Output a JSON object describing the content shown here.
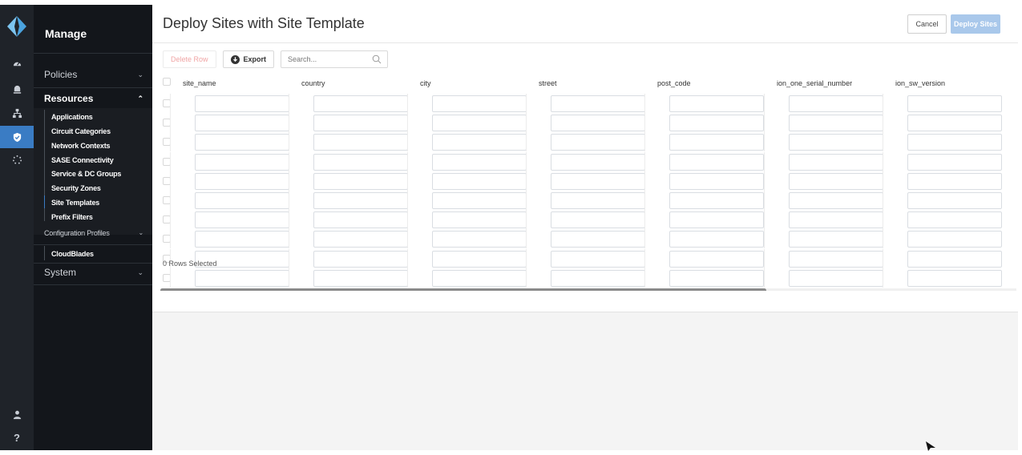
{
  "app": {
    "logo": "prisma-logo-icon"
  },
  "rail": {
    "icons": [
      "dashboard-gauge-icon",
      "alerts-bell-icon",
      "network-topology-icon",
      "shield-check-icon",
      "spinner-dots-icon",
      "user-icon",
      "help-question-icon"
    ],
    "active_index": 3,
    "help_glyph": "?"
  },
  "sidebar": {
    "title": "Manage",
    "sections": [
      {
        "label": "Policies",
        "expanded": false
      },
      {
        "label": "Resources",
        "expanded": true
      },
      {
        "label": "System",
        "expanded": false
      }
    ],
    "resources_items": [
      {
        "label": "Applications"
      },
      {
        "label": "Circuit Categories"
      },
      {
        "label": "Network Contexts"
      },
      {
        "label": "SASE Connectivity"
      },
      {
        "label": "Service & DC Groups"
      },
      {
        "label": "Security Zones"
      },
      {
        "label": "Site Templates",
        "selected": true
      },
      {
        "label": "Prefix Filters"
      },
      {
        "label": "Configuration Profiles",
        "expandable": true
      },
      {
        "label": "CloudBlades"
      }
    ]
  },
  "page": {
    "title": "Deploy Sites with Site Template",
    "cancel_label": "Cancel",
    "deploy_label": "Deploy Sites"
  },
  "toolbar": {
    "delete_label": "Delete Row",
    "export_label": "Export",
    "search_placeholder": "Search..."
  },
  "grid": {
    "columns": [
      "site_name",
      "country",
      "city",
      "street",
      "post_code",
      "ion_one_serial_number",
      "ion_sw_version"
    ],
    "row_count": 10,
    "status": "0 Rows Selected"
  },
  "colors": {
    "accent": "#3a7cc4",
    "deploy_disabled": "#a9c8eb",
    "sidebar_bg": "#13161b",
    "rail_bg": "#1f2329",
    "logo": "#4aa3df"
  }
}
